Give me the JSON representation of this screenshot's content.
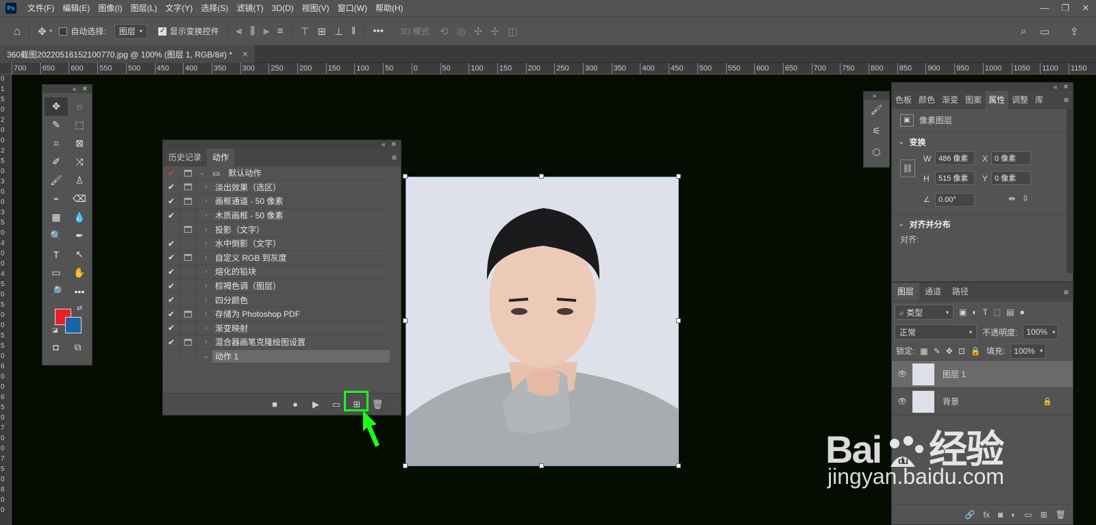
{
  "app": {
    "logo": "Ps"
  },
  "menu": [
    "文件(F)",
    "编辑(E)",
    "图像(I)",
    "图层(L)",
    "文字(Y)",
    "选择(S)",
    "滤镜(T)",
    "3D(D)",
    "视图(V)",
    "窗口(W)",
    "帮助(H)"
  ],
  "window_controls": {
    "minimize": "—",
    "restore": "❐",
    "close": "✕"
  },
  "options_bar": {
    "auto_select_label": "自动选择:",
    "auto_select_target": "图层",
    "show_transform_label": "显示变换控件",
    "mode_3d_label": "3D 模式:",
    "more": "•••"
  },
  "document_tab": {
    "title": "360截图20220516152100770.jpg @ 100% (图层 1, RGB/8#) *",
    "close": "✕"
  },
  "ruler": {
    "h_ticks": [
      "700",
      "650",
      "600",
      "550",
      "500",
      "450",
      "400",
      "350",
      "300",
      "250",
      "200",
      "150",
      "100",
      "50",
      "0",
      "50",
      "100",
      "150",
      "200",
      "250",
      "300",
      "350",
      "400",
      "450",
      "500",
      "550",
      "600",
      "650",
      "700",
      "750",
      "800",
      "850",
      "900",
      "950",
      "1000",
      "1050",
      "1100",
      "1150"
    ],
    "v_ticks": [
      "0",
      "1",
      "5",
      "0",
      "2",
      "0",
      "0",
      "2",
      "5",
      "0",
      "3",
      "0",
      "0",
      "3",
      "5",
      "0",
      "4",
      "0",
      "0",
      "4",
      "5",
      "0",
      "5",
      "0",
      "0",
      "5",
      "5",
      "0",
      "6",
      "0",
      "0",
      "6",
      "5",
      "0",
      "7",
      "0",
      "0",
      "7",
      "5",
      "0",
      "8",
      "0",
      "0"
    ]
  },
  "toolbox": {
    "collapse": "«",
    "close": "✕",
    "tools": [
      "✥",
      "◌",
      "✎",
      "⬚",
      "⌗",
      "⊠",
      "✐",
      "⤨",
      "🖌",
      "♙",
      "⌁",
      "⌫",
      "▦",
      "💧",
      "🔍",
      "✒",
      "T",
      "↖",
      "▭",
      "✋",
      "🔎",
      "•••"
    ],
    "fg_color": "#e8202a",
    "bg_color": "#1b63a8"
  },
  "actions_panel": {
    "collapse": "«",
    "close": "✕",
    "menu": "≡",
    "tabs": [
      "历史记录",
      "动作"
    ],
    "rows": [
      {
        "check": "✔",
        "dialog": true,
        "arrow": "⌄",
        "label": "默认动作",
        "folder": true,
        "red": true
      },
      {
        "check": "✔",
        "dialog": true,
        "arrow": "›",
        "label": "淡出效果（选区）"
      },
      {
        "check": "✔",
        "dialog": true,
        "arrow": "›",
        "label": "画框通道 - 50 像素"
      },
      {
        "check": "✔",
        "dialog": false,
        "arrow": "›",
        "label": "木质画框 - 50 像素"
      },
      {
        "check": "",
        "dialog": true,
        "arrow": "›",
        "label": "投影（文字）"
      },
      {
        "check": "✔",
        "dialog": false,
        "arrow": "›",
        "label": "水中倒影（文字）"
      },
      {
        "check": "✔",
        "dialog": true,
        "arrow": "›",
        "label": "自定义 RGB 到灰度"
      },
      {
        "check": "✔",
        "dialog": false,
        "arrow": "›",
        "label": "熔化的铅块"
      },
      {
        "check": "✔",
        "dialog": false,
        "arrow": "›",
        "label": "棕褐色调（图层）"
      },
      {
        "check": "✔",
        "dialog": false,
        "arrow": "›",
        "label": "四分颜色"
      },
      {
        "check": "✔",
        "dialog": true,
        "arrow": "›",
        "label": "存储为 Photoshop PDF"
      },
      {
        "check": "✔",
        "dialog": false,
        "arrow": "›",
        "label": "渐变映射"
      },
      {
        "check": "✔",
        "dialog": true,
        "arrow": "›",
        "label": "混合器画笔克隆绘图设置"
      },
      {
        "check": "",
        "dialog": false,
        "arrow": "⌄",
        "label": "动作 1",
        "selected": true
      }
    ],
    "buttons": [
      "■",
      "●",
      "▶",
      "▭",
      "⊞",
      "🗑"
    ]
  },
  "properties_panel": {
    "strip_collapse": "»",
    "collapse": "«",
    "close": "✕",
    "menu": "≡",
    "tabs": [
      "色板",
      "颜色",
      "渐变",
      "图案",
      "属性",
      "调整",
      "库"
    ],
    "layer_type": "像素图层",
    "transform_title": "变换",
    "w_label": "W",
    "w_value": "486 像素",
    "h_label": "H",
    "h_value": "515 像素",
    "x_label": "X",
    "x_value": "0 像素",
    "y_label": "Y",
    "y_value": "0 像素",
    "angle_value": "0.00°",
    "align_title": "对齐并分布",
    "align_label": "对齐:"
  },
  "layers_panel": {
    "tabs": [
      "图层",
      "通道",
      "路径"
    ],
    "menu": "≡",
    "filter_label": "类型",
    "blend_mode": "正常",
    "opacity_label": "不透明度:",
    "opacity_value": "100%",
    "lock_label": "锁定:",
    "fill_label": "填充:",
    "fill_value": "100%",
    "layers": [
      {
        "name": "图层 1",
        "selected": true
      },
      {
        "name": "背景",
        "locked": true
      }
    ],
    "footer_icons": [
      "🔗",
      "fx",
      "◙",
      "◐",
      "▭",
      "⊞",
      "🗑"
    ]
  },
  "watermark": {
    "brand": "Bai",
    "brand2": "经验",
    "url": "jingyan.baidu.com"
  }
}
